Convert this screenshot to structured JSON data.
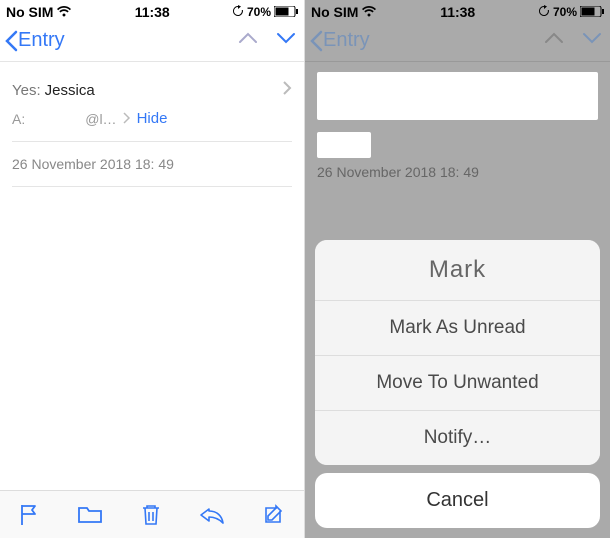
{
  "left": {
    "status": {
      "sim": "No SIM",
      "time": "11:38",
      "battery": "70%"
    },
    "nav": {
      "back_label": "Entry"
    },
    "header": {
      "from_label": "Yes:",
      "from_value": "Jessica",
      "to_label": "A:",
      "to_domain": "@l…",
      "hide_label": "Hide"
    },
    "timestamp": "26 November 2018 18: 49"
  },
  "right": {
    "status": {
      "sim": "No SIM",
      "time": "11:38",
      "battery": "70%"
    },
    "nav": {
      "back_label": "Entry"
    },
    "timestamp": "26 November 2018 18: 49",
    "sheet": {
      "title": "Mark",
      "unread": "Mark As Unread",
      "unwanted": "Move To Unwanted",
      "notify": "Notify…",
      "cancel": "Cancel"
    }
  }
}
